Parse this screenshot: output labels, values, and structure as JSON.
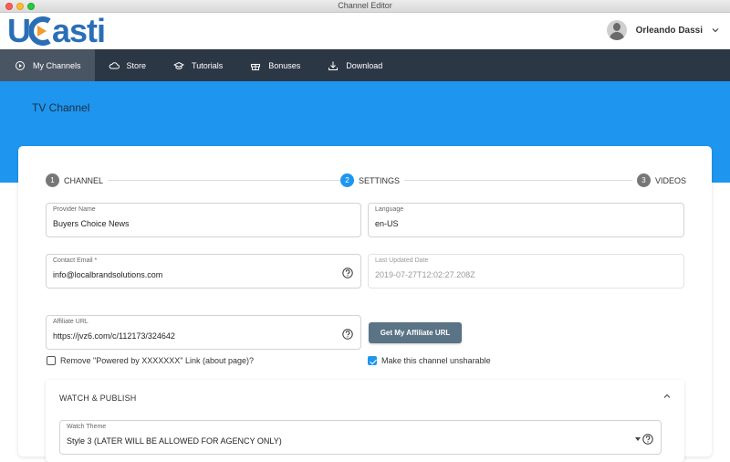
{
  "window": {
    "title": "Channel Editor"
  },
  "header": {
    "logo": {
      "part1": "U",
      "part2": "asti"
    },
    "user_name": "Orleando Dassi"
  },
  "nav": {
    "items": [
      {
        "label": "My Channels",
        "icon": "play-circle-icon",
        "active": true
      },
      {
        "label": "Store",
        "icon": "cloud-icon"
      },
      {
        "label": "Tutorials",
        "icon": "graduation-cap-icon"
      },
      {
        "label": "Bonuses",
        "icon": "gift-icon"
      },
      {
        "label": "Download",
        "icon": "download-icon"
      }
    ]
  },
  "page": {
    "title": "TV Channel"
  },
  "stepper": {
    "steps": [
      {
        "num": "1",
        "label": "CHANNEL"
      },
      {
        "num": "2",
        "label": "SETTINGS",
        "active": true
      },
      {
        "num": "3",
        "label": "VIDEOS"
      }
    ]
  },
  "form": {
    "provider_name": {
      "label": "Provider Name",
      "value": "Buyers Choice News"
    },
    "language": {
      "label": "Language",
      "value": "en-US"
    },
    "contact_email": {
      "label": "Contact Email *",
      "value": "info@localbrandsolutions.com"
    },
    "last_updated": {
      "label": "Last Updated Date",
      "value": "2019-07-27T12:02:27.208Z"
    },
    "affiliate_url": {
      "label": "Affiliate URL",
      "value": "https://jvz6.com/c/112173/324642"
    },
    "get_affiliate_button": "Get My Affiliate URL",
    "remove_powered_by": {
      "label": "Remove \"Powered by XXXXXXX\" Link (about page)?",
      "checked": false
    },
    "unsharable": {
      "label": "Make this channel unsharable",
      "checked": true
    }
  },
  "watch_publish": {
    "title": "WATCH & PUBLISH",
    "watch_theme": {
      "label": "Watch Theme",
      "value": "Style 3 (LATER WILL BE ALLOWED FOR AGENCY ONLY)"
    }
  },
  "colors": {
    "accent": "#1e96f0",
    "nav_bg": "#2c3746",
    "button": "#5a7385",
    "logo_blue": "#2a6fb6",
    "logo_orange": "#f29a2e"
  }
}
